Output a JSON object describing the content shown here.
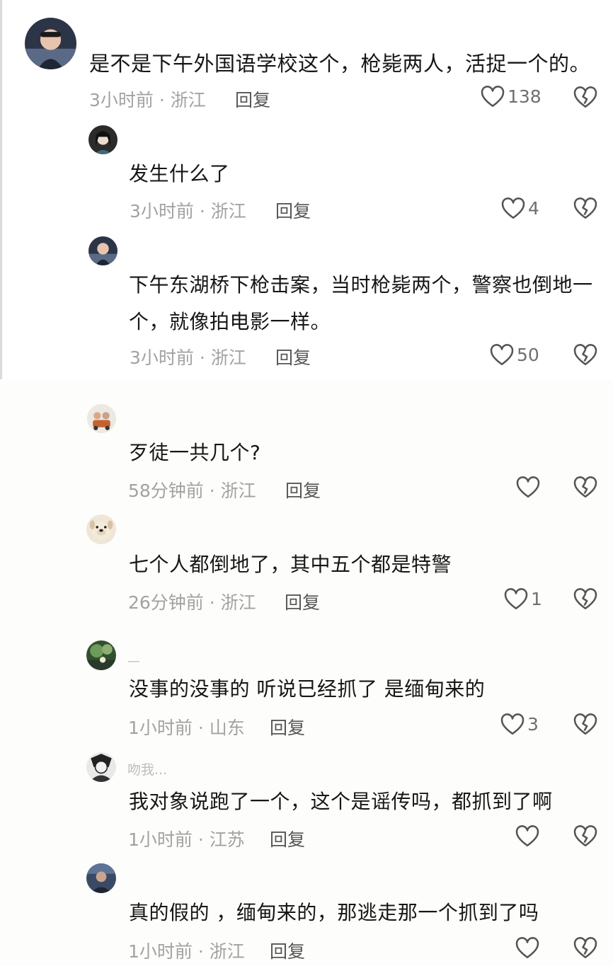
{
  "comments": [
    {
      "avatar_icon": "user-avatar-icon",
      "username": "",
      "text": "是不是下午外国语学校这个，枪毙两人，活捉一个的。",
      "time": "3小时前",
      "location": "浙江",
      "reply_label": "回复",
      "likes": "138"
    },
    {
      "avatar_icon": "user-avatar-icon",
      "username": "",
      "text": "发生什么了",
      "time": "3小时前",
      "location": "浙江",
      "reply_label": "回复",
      "likes": "4"
    },
    {
      "avatar_icon": "user-avatar-icon",
      "username": "",
      "text": "下午东湖桥下枪击案，当时枪毙两个，警察也倒地一个，就像拍电影一样。",
      "time": "3小时前",
      "location": "浙江",
      "reply_label": "回复",
      "likes": "50"
    },
    {
      "avatar_icon": "user-avatar-icon",
      "username": "",
      "text": "歹徒一共几个?",
      "time": "58分钟前",
      "location": "浙江",
      "reply_label": "回复",
      "likes": ""
    },
    {
      "avatar_icon": "dog-avatar-icon",
      "username": "",
      "text": "七个人都倒地了，其中五个都是特警",
      "time": "26分钟前",
      "location": "浙江",
      "reply_label": "回复",
      "likes": "1"
    },
    {
      "avatar_icon": "user-avatar-icon",
      "username": "—",
      "text": "没事的没事的 听说已经抓了 是缅甸来的",
      "time": "1小时前",
      "location": "山东",
      "reply_label": "回复",
      "likes": "3"
    },
    {
      "avatar_icon": "user-avatar-icon",
      "username": "吻我...",
      "text": "我对象说跑了一个，这个是谣传吗，都抓到了啊",
      "time": "1小时前",
      "location": "江苏",
      "reply_label": "回复",
      "likes": ""
    },
    {
      "avatar_icon": "user-avatar-icon",
      "username": "",
      "text": "真的假的 ，缅甸来的，那逃走那一个抓到了吗",
      "time": "1小时前",
      "location": "浙江",
      "reply_label": "回复",
      "likes": ""
    }
  ],
  "meta_separator": " · ",
  "icons": {
    "like": "heart-outline-icon",
    "dislike": "broken-heart-icon"
  },
  "colors": {
    "text": "#161616",
    "meta": "#a2a2a2",
    "reply": "#565656",
    "icon": "#555555"
  }
}
